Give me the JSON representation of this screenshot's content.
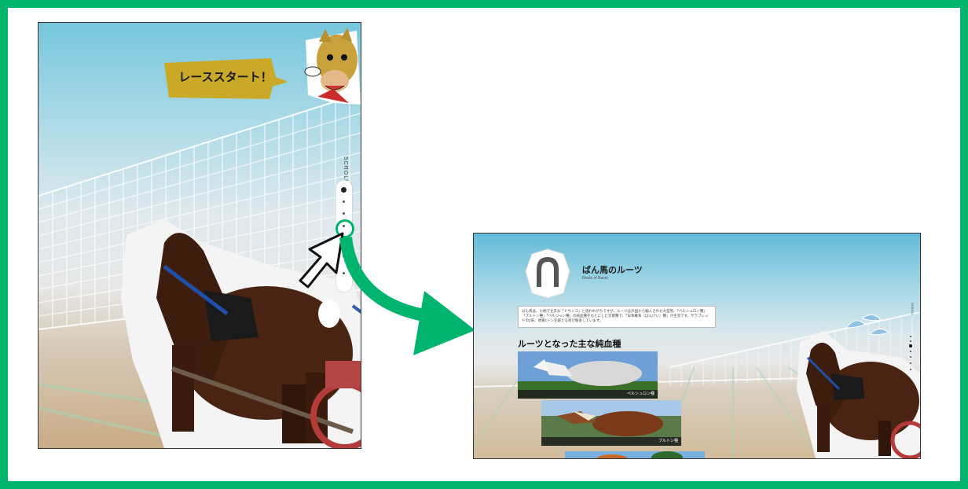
{
  "left_screen": {
    "speech_bubble": "レーススタート！",
    "scroll_label": "SCROLL",
    "scroll_dots_count": 7,
    "active_dot_index": 0,
    "highlighted_dot_index": 3
  },
  "right_screen": {
    "title": "ばん馬のルーツ",
    "subtitle": "Roots of Banei",
    "intro_text": "ばん馬は、小柄で丈夫な「ドサンコ」と思われがちですが、ルーツは外国から輸入された大型馬、「ペルシュロン種」「ブルトン種」「ベルジャン種」の純血種をもとにした交雑種で、「日本輓系（ばんけい）種」が主流です。サラブレッドの2倍、体重1トンを越える馬が競争しています。",
    "section_heading": "ルーツとなった主な純血種",
    "breeds": [
      {
        "caption": "ペルシュロン種"
      },
      {
        "caption": "ブルトン種"
      },
      {
        "caption": ""
      }
    ],
    "scroll_label": "SCROLL",
    "scroll_dots_count": 7,
    "active_dot_index": 2
  },
  "colors": {
    "frame": "#00b46e",
    "arrow": "#00b46e",
    "bubble": "#c9a927"
  }
}
